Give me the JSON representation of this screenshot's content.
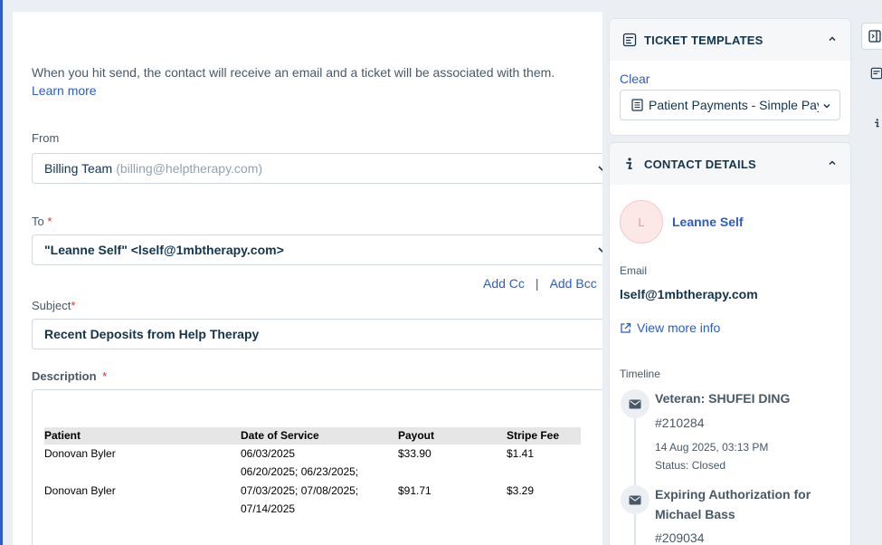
{
  "compose": {
    "info_text": "When you hit send, the contact will receive an email and a ticket will be associated with them.",
    "learn_more": "Learn more",
    "from_label": "From",
    "from_name": "Billing Team",
    "from_email": "(billing@helptherapy.com)",
    "to_label": "To",
    "required_mark": "*",
    "to_value": "\"Leanne Self\" <lself@1mbtherapy.com>",
    "add_cc": "Add Cc",
    "separator": "|",
    "add_bcc": "Add Bcc",
    "subject_label": "Subject",
    "subject_value": "Recent Deposits from Help Therapy",
    "description_label": "Description"
  },
  "description_table": {
    "headers": [
      "Patient",
      "Date of Service",
      "Payout",
      "Stripe Fee"
    ],
    "rows": [
      {
        "patient": "Donovan Byler",
        "date1": "06/03/2025",
        "date2": "",
        "payout": "$33.90",
        "fee": "$1.41"
      },
      {
        "patient": "",
        "date1": "06/20/2025; 06/23/2025;",
        "date2": "",
        "payout": "",
        "fee": ""
      },
      {
        "patient": "Donovan Byler",
        "date1": "07/03/2025; 07/08/2025;",
        "date2": "07/14/2025",
        "payout": "$91.71",
        "fee": "$3.29"
      }
    ]
  },
  "ticket_templates": {
    "title": "TICKET TEMPLATES",
    "clear": "Clear",
    "selected": "Patient Payments - Simple Payment"
  },
  "contact_details": {
    "title": "CONTACT DETAILS",
    "avatar_initial": "L",
    "name": "Leanne Self",
    "email_label": "Email",
    "email": "lself@1mbtherapy.com",
    "view_more": "View more info",
    "timeline_label": "Timeline",
    "timeline": [
      {
        "title": "Veteran: SHUFEI DING",
        "number": "#210284",
        "date": "14 Aug 2025, 03:13 PM",
        "status": "Status: Closed"
      },
      {
        "title": "Expiring Authorization for Michael Bass",
        "number": "#209034"
      }
    ]
  },
  "colors": {
    "accent": "#2c5cc5",
    "required": "#d72d30",
    "text": "#12344d"
  }
}
